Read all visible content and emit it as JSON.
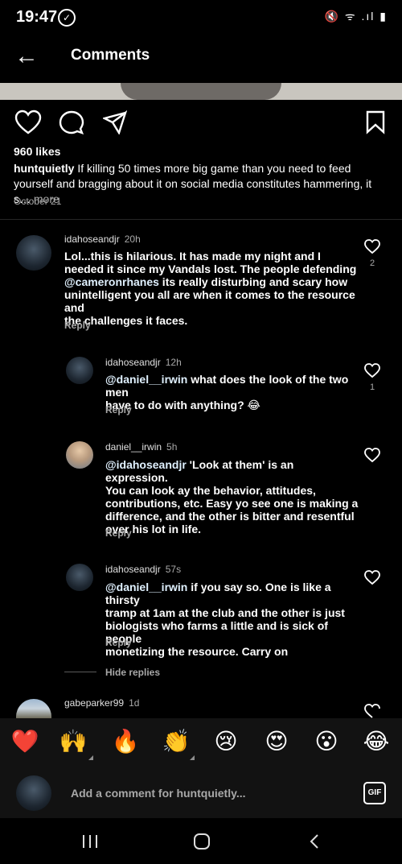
{
  "status": {
    "time": "19:47",
    "check_glyph": "✓",
    "right_icons": "🔇 ᯤ .ıl ▮"
  },
  "header": {
    "back_glyph": "←",
    "title": "Comments"
  },
  "post": {
    "likes": "960 likes",
    "username": "huntquietly",
    "caption": "If killing 50 times more big game than you need to feed yourself and bragging about it on social media constitutes hammering, it s…",
    "more": "more",
    "date": "October 21"
  },
  "comments": [
    {
      "username": "idahoseandjr",
      "time": "20h",
      "mention": "",
      "lines": [
        "Lol...this is hilarious.  It has made my night and I",
        "needed it since my Vandals lost.  The people defending"
      ],
      "mention_line_mention": "@cameronrhanes",
      "mention_line_rest": " its really disturbing and scary how",
      "tail_lines": [
        "unintelligent you all are when it comes to  the resource and",
        "the challenges it faces."
      ],
      "reply": "Reply",
      "likes": "2"
    },
    {
      "username": "idahoseandjr",
      "time": "12h",
      "mention": "@daniel__irwin",
      "first_rest": " what does the look of the two men",
      "lines": [
        "have to do with anything? 😂"
      ],
      "reply": "Reply",
      "likes": "1"
    },
    {
      "username": "daniel__irwin",
      "time": "5h",
      "mention": "@idahoseandjr",
      "first_rest": " 'Look at them' is an expression.",
      "lines": [
        "You can look ay the behavior, attitudes,",
        "contributions, etc. Easy yo see one is making a",
        "difference, and the other is bitter and resentful",
        "over his lot in life."
      ],
      "reply": "Reply",
      "likes": ""
    },
    {
      "username": "idahoseandjr",
      "time": "57s",
      "mention": "@daniel__irwin",
      "first_rest": " if you say so.  One is like a thirsty",
      "lines": [
        "tramp at 1am at the club and the other is just",
        "biologists who farms a little and is sick of people",
        "monetizing the resource.  Carry on"
      ],
      "reply": "Reply",
      "likes": ""
    }
  ],
  "hide_replies": "Hide replies",
  "next_comment": {
    "username": "gabeparker99",
    "time": "1d"
  },
  "emoji_bar": [
    "❤️",
    "🙌",
    "🔥",
    "👏",
    "😢",
    "😍",
    "😮",
    "😂"
  ],
  "composer": {
    "placeholder": "Add a comment for huntquietly...",
    "gif_label": "GIF"
  },
  "nav": {
    "recents_glyph": "|||",
    "home_glyph": "▢",
    "back_glyph": "‹"
  },
  "colors": {
    "background": "#000000",
    "secondary_text": "#a8a8a8",
    "mention": "#e0f1ff",
    "surface": "#121212"
  }
}
